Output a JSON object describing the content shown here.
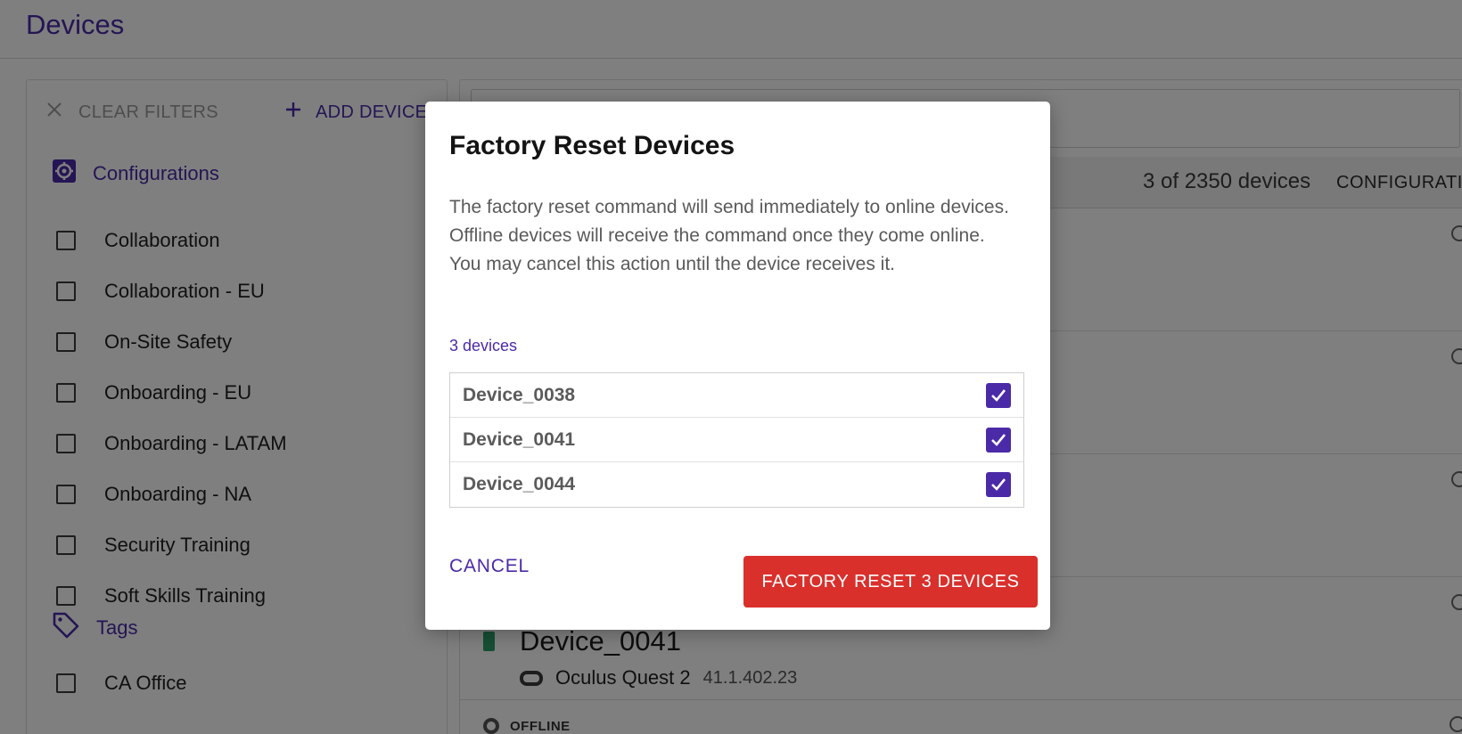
{
  "header": {
    "title": "Devices"
  },
  "sidebar": {
    "clear_filters": "CLEAR FILTERS",
    "add_device": "ADD DEVICE",
    "configurations_title": "Configurations",
    "configurations": [
      "Collaboration",
      "Collaboration - EU",
      "On-Site Safety",
      "Onboarding - EU",
      "Onboarding - LATAM",
      "Onboarding - NA",
      "Security Training",
      "Soft Skills Training"
    ],
    "tags_title": "Tags",
    "tags": [
      "CA Office"
    ]
  },
  "list": {
    "count": "3 of 2350 devices",
    "configurations_col": "CONFIGURATIONS",
    "visible_device": {
      "name": "Device_0041",
      "model": "Oculus Quest 2",
      "version": "41.1.402.23"
    },
    "next_status": "OFFLINE"
  },
  "modal": {
    "title": "Factory Reset Devices",
    "body": "The factory reset command will send immediately to online devices. Offline devices will receive the command once they come online. You may cancel this action until the device receives it.",
    "device_count": "3 devices",
    "devices": [
      {
        "name": "Device_0038",
        "checked": true
      },
      {
        "name": "Device_0041",
        "checked": true
      },
      {
        "name": "Device_0044",
        "checked": true
      }
    ],
    "cancel_label": "CANCEL",
    "confirm_label": "FACTORY RESET 3 DEVICES"
  },
  "colors": {
    "accent": "#4b2aa8",
    "danger": "#d9302c",
    "online": "#2f9e6b"
  },
  "icons": {
    "clear": "close-icon",
    "add": "plus-icon",
    "configurations": "gear-icon",
    "tags": "tag-icon",
    "check": "check-icon"
  }
}
